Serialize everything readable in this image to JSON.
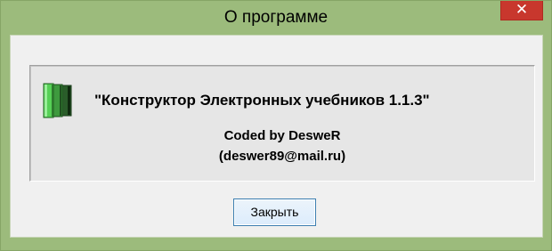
{
  "window": {
    "title": "О программе",
    "close_glyph": "✕",
    "frame_color": "#9cbb7c",
    "close_button_color": "#c8372d"
  },
  "about": {
    "icon": "book-icon",
    "product_name": "\"Конструктор Электронных учебников 1.1.3\"",
    "coded_by": "Coded by DesweR",
    "email": "(deswer89@mail.ru)"
  },
  "buttons": {
    "close_label": "Закрыть"
  }
}
